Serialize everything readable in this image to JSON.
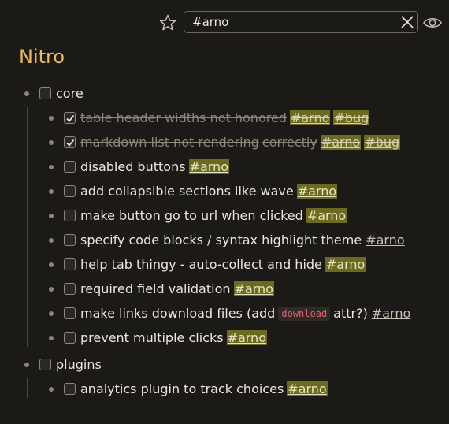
{
  "search": {
    "value": "#arno"
  },
  "title": "Nitro",
  "groups": [
    {
      "label": "core",
      "items": [
        {
          "text": "table header widths not honored",
          "tags": [
            "#arno",
            "#bug"
          ],
          "done": true
        },
        {
          "text": "markdown list not rendering",
          "text2": "correctly",
          "tags": [
            "#arno",
            "#bug"
          ],
          "done": true
        },
        {
          "text": "disabled buttons",
          "tags": [
            "#arno"
          ],
          "done": false
        },
        {
          "text": "add collapsible sections like wave",
          "tags": [
            "#arno"
          ],
          "done": false
        },
        {
          "text": "make button go to url when clicked",
          "tags": [
            "#arno"
          ],
          "done": false
        },
        {
          "text": "specify code blocks / syntax highlight theme",
          "tags": [
            "#arno"
          ],
          "done": false,
          "plainTag": true
        },
        {
          "text": "help tab thingy - auto-collect and hide",
          "tags": [
            "#arno"
          ],
          "done": false
        },
        {
          "text": "required field validation",
          "tags": [
            "#arno"
          ],
          "done": false
        },
        {
          "text": "make links download files (add",
          "code": "download",
          "text2": "attr?)",
          "tags": [
            "#arno"
          ],
          "done": false,
          "plainTag": true
        },
        {
          "text": "prevent multiple clicks",
          "tags": [
            "#arno"
          ],
          "done": false
        }
      ]
    },
    {
      "label": "plugins",
      "items": [
        {
          "text": "analytics plugin to track choices",
          "tags": [
            "#arno"
          ],
          "done": false
        }
      ]
    }
  ]
}
